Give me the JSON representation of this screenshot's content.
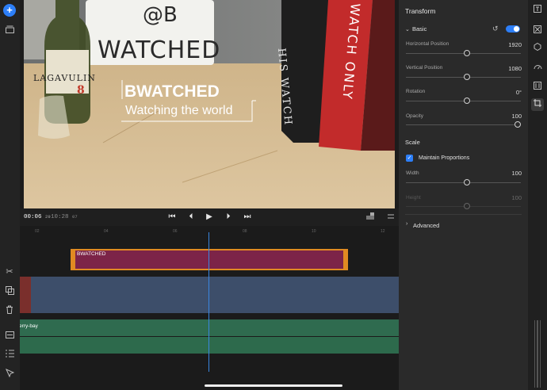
{
  "preview": {
    "overlay_title": "BWATCHED",
    "overlay_subtitle": "Watching the world",
    "sign_line1": "@B",
    "sign_line2": "WATCHED",
    "bottle_label": "LAGAVULIN",
    "bottle_number": "8",
    "book1": "HIS WATCH",
    "book2": "WATCH ONLY"
  },
  "transport": {
    "current_time": "00:06",
    "current_frames": "29",
    "duration": "10:28",
    "duration_frames": "07"
  },
  "timeline": {
    "ruler": [
      "02",
      "04",
      "06",
      "08",
      "10",
      "12"
    ],
    "title_clip_label": "BWATCHED",
    "audio_clip_label": "erry-bay"
  },
  "panel": {
    "title": "Transform",
    "basic_label": "Basic",
    "horizontal_label": "Horizontal Position",
    "horizontal_value": "1920",
    "horizontal_level": 0.53,
    "vertical_label": "Vertical Position",
    "vertical_value": "1080",
    "vertical_level": 0.53,
    "rotation_label": "Rotation",
    "rotation_value": "0°",
    "rotation_level": 0.53,
    "opacity_label": "Opacity",
    "opacity_value": "100",
    "opacity_level": 1.0,
    "scale_label": "Scale",
    "maintain_label": "Maintain Proportions",
    "width_label": "Width",
    "width_value": "100",
    "width_level": 0.53,
    "height_label": "Height",
    "height_value": "100",
    "height_level": 0.53,
    "advanced_label": "Advanced"
  },
  "colors": {
    "accent": "#2d7ff9",
    "title_clip": "#7c2448",
    "clip_border": "#e08a22",
    "video_clip": "#3d4e6a",
    "audio_clip": "#2f6b4f",
    "playhead": "#3a86e0"
  }
}
